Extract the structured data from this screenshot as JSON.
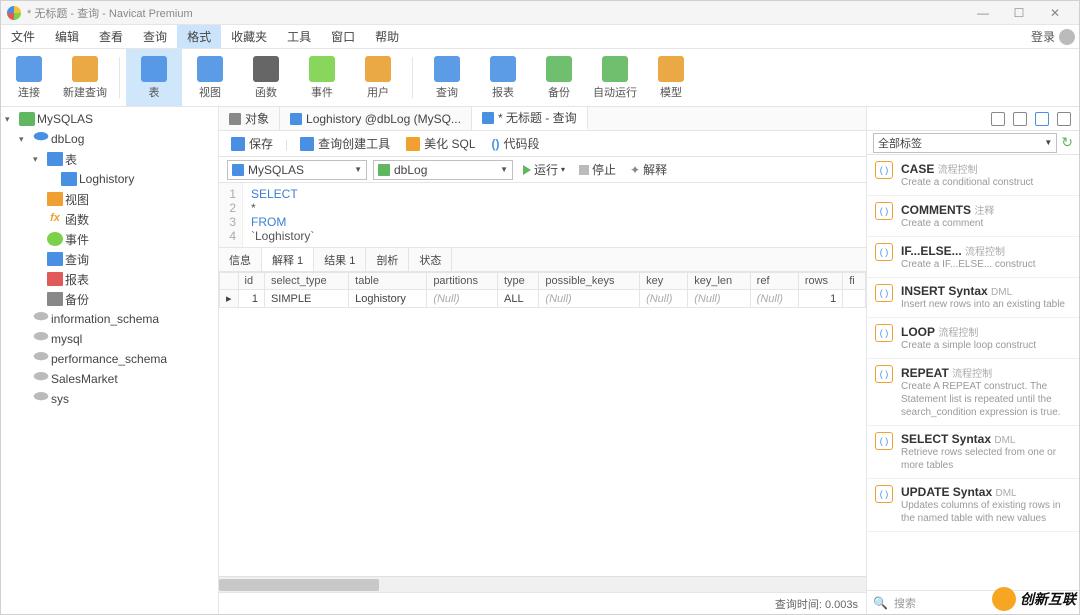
{
  "title": "* 无标题 - 查询 - Navicat Premium",
  "menubar": [
    "文件",
    "编辑",
    "查看",
    "查询",
    "格式",
    "收藏夹",
    "工具",
    "窗口",
    "帮助"
  ],
  "menubar_active": 4,
  "login": "登录",
  "toolbar": [
    {
      "label": "连接",
      "icon": "connect"
    },
    {
      "label": "新建查询",
      "icon": "newquery"
    },
    {
      "label": "表",
      "icon": "table",
      "sel": true
    },
    {
      "label": "视图",
      "icon": "view"
    },
    {
      "label": "函数",
      "icon": "fx"
    },
    {
      "label": "事件",
      "icon": "event"
    },
    {
      "label": "用户",
      "icon": "user"
    },
    {
      "label": "查询",
      "icon": "query"
    },
    {
      "label": "报表",
      "icon": "report"
    },
    {
      "label": "备份",
      "icon": "backup"
    },
    {
      "label": "自动运行",
      "icon": "auto"
    },
    {
      "label": "模型",
      "icon": "model"
    }
  ],
  "tree": {
    "conn": "MySQLAS",
    "db": "dbLog",
    "tables_node": "表",
    "table1": "Loghistory",
    "nodes": [
      "视图",
      "函数",
      "事件",
      "查询",
      "报表",
      "备份"
    ],
    "other_dbs": [
      "information_schema",
      "mysql",
      "performance_schema",
      "SalesMarket",
      "sys"
    ]
  },
  "tabs": [
    "对象",
    "Loghistory @dbLog (MySQ...",
    "* 无标题 - 查询"
  ],
  "qtoolbar": {
    "save": "保存",
    "builder": "查询创建工具",
    "beautify": "美化 SQL",
    "snippets": "代码段"
  },
  "conn_combo": "MySQLAS",
  "db_combo": "dbLog",
  "run": "运行",
  "stop": "停止",
  "explain": "解释",
  "sql_lines": [
    "SELECT",
    "    *",
    "FROM",
    "    `Loghistory`"
  ],
  "result_tabs": [
    "信息",
    "解释 1",
    "结果 1",
    "剖析",
    "状态"
  ],
  "result_active": 1,
  "grid": {
    "cols": [
      "id",
      "select_type",
      "table",
      "partitions",
      "type",
      "possible_keys",
      "key",
      "key_len",
      "ref",
      "rows",
      "fi"
    ],
    "row": {
      "id": "1",
      "select_type": "SIMPLE",
      "table": "Loghistory",
      "partitions": "(Null)",
      "type": "ALL",
      "possible_keys": "(Null)",
      "key": "(Null)",
      "key_len": "(Null)",
      "ref": "(Null)",
      "rows": "1",
      "fi": ""
    }
  },
  "status": "查询时间: 0.003s",
  "filter_label": "全部标签",
  "snippets": [
    {
      "h": "CASE",
      "t": "流程控制",
      "d": "Create a conditional construct"
    },
    {
      "h": "COMMENTS",
      "t": "注释",
      "d": "Create a comment"
    },
    {
      "h": "IF...ELSE...",
      "t": "流程控制",
      "d": "Create a IF...ELSE... construct"
    },
    {
      "h": "INSERT Syntax",
      "t": "DML",
      "d": "Insert new rows into an existing table"
    },
    {
      "h": "LOOP",
      "t": "流程控制",
      "d": "Create a simple loop construct"
    },
    {
      "h": "REPEAT",
      "t": "流程控制",
      "d": "Create A REPEAT construct. The Statement list is repeated until the search_condition expression is true."
    },
    {
      "h": "SELECT Syntax",
      "t": "DML",
      "d": "Retrieve rows selected from one or more tables"
    },
    {
      "h": "UPDATE Syntax",
      "t": "DML",
      "d": "Updates columns of existing rows in the named table with new values"
    }
  ],
  "search_placeholder": "搜索",
  "brand": "创新互联"
}
